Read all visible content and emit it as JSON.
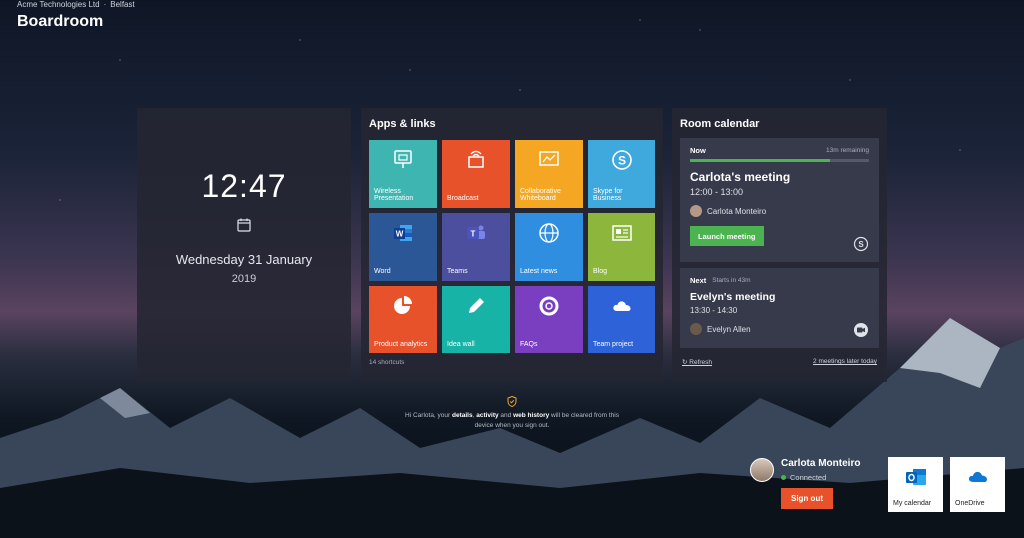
{
  "header": {
    "company": "Acme Technologies Ltd",
    "separator": "·",
    "location": "Belfast",
    "room": "Boardroom"
  },
  "clock": {
    "time": "12:47",
    "date": "Wednesday 31 January",
    "year": "2019"
  },
  "apps": {
    "title": "Apps & links",
    "tiles": [
      {
        "label": "Wireless Presentation",
        "color": "#3fb5b2",
        "icon": "cast-icon"
      },
      {
        "label": "Broadcast",
        "color": "#e8522b",
        "icon": "broadcast-icon"
      },
      {
        "label": "Collaborative Whiteboard",
        "color": "#f5a623",
        "icon": "whiteboard-icon"
      },
      {
        "label": "Skype for Business",
        "color": "#3fa9dd",
        "icon": "skype-icon"
      },
      {
        "label": "Word",
        "color": "#2b5797",
        "icon": "word-icon"
      },
      {
        "label": "Teams",
        "color": "#4b4f9d",
        "icon": "teams-icon"
      },
      {
        "label": "Latest news",
        "color": "#2f8ee0",
        "icon": "globe-icon"
      },
      {
        "label": "Blog",
        "color": "#8cb63c",
        "icon": "newspaper-icon"
      },
      {
        "label": "Product analytics",
        "color": "#e8522b",
        "icon": "pie-chart-icon"
      },
      {
        "label": "Idea wall",
        "color": "#16b3a6",
        "icon": "pencil-icon"
      },
      {
        "label": "FAQs",
        "color": "#7a3fc1",
        "icon": "lifebuoy-icon"
      },
      {
        "label": "Team project",
        "color": "#2d62d8",
        "icon": "cloud-icon"
      }
    ],
    "shortcuts": "14 shortcuts"
  },
  "calendar": {
    "title": "Room calendar",
    "now": {
      "label": "Now",
      "remaining": "13m remaining",
      "progress": 0.78,
      "title": "Carlota's meeting",
      "time": "12:00 - 13:00",
      "organizer": "Carlota Monteiro",
      "launch": "Launch meeting",
      "icon": "skype-icon"
    },
    "next": {
      "label": "Next",
      "starts": "Starts in 43m",
      "title": "Evelyn's meeting",
      "time": "13:30 - 14:30",
      "organizer": "Evelyn Allen",
      "icon": "video-camera-icon"
    },
    "refresh": "Refresh",
    "later": "2 meetings later today"
  },
  "privacy": {
    "prefix": "Hi Carlota, your ",
    "details": "details",
    "comma": ", ",
    "activity": "activity",
    "and": " and ",
    "history": "web history",
    "suffix": " will be cleared from this device when you sign out."
  },
  "user": {
    "name": "Carlota Monteiro",
    "status": "Connected",
    "signout": "Sign out"
  },
  "quick_apps": [
    {
      "label": "My calendar",
      "icon": "outlook-icon"
    },
    {
      "label": "OneDrive",
      "icon": "onedrive-icon"
    }
  ]
}
